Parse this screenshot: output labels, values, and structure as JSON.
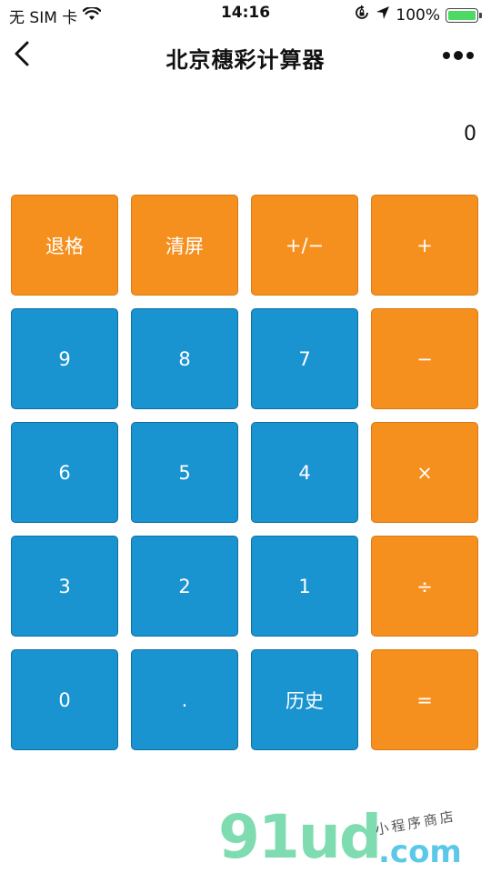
{
  "status_bar": {
    "carrier": "无 SIM 卡",
    "time": "14:16",
    "battery": "100%",
    "battery_level": 1.0,
    "battery_color": "#4cd964"
  },
  "nav": {
    "title": "北京穗彩计算器",
    "back_icon": "chevron-left-icon",
    "more_icon": "more-dots-icon"
  },
  "display": {
    "value": "0"
  },
  "keypad": {
    "colors": {
      "operator": "#f5901f",
      "digit": "#1a93d1"
    },
    "keys": [
      {
        "label": "退格",
        "type": "operator"
      },
      {
        "label": "清屏",
        "type": "operator"
      },
      {
        "label": "+/−",
        "type": "operator"
      },
      {
        "label": "+",
        "type": "operator"
      },
      {
        "label": "9",
        "type": "digit"
      },
      {
        "label": "8",
        "type": "digit"
      },
      {
        "label": "7",
        "type": "digit"
      },
      {
        "label": "−",
        "type": "operator"
      },
      {
        "label": "6",
        "type": "digit"
      },
      {
        "label": "5",
        "type": "digit"
      },
      {
        "label": "4",
        "type": "digit"
      },
      {
        "label": "×",
        "type": "operator"
      },
      {
        "label": "3",
        "type": "digit"
      },
      {
        "label": "2",
        "type": "digit"
      },
      {
        "label": "1",
        "type": "digit"
      },
      {
        "label": "÷",
        "type": "operator"
      },
      {
        "label": "0",
        "type": "digit"
      },
      {
        "label": ".",
        "type": "digit"
      },
      {
        "label": "历史",
        "type": "digit"
      },
      {
        "label": "=",
        "type": "operator"
      }
    ]
  },
  "watermark": {
    "logo": "91ud",
    "domain": ".com",
    "tag": "小程序商店"
  }
}
